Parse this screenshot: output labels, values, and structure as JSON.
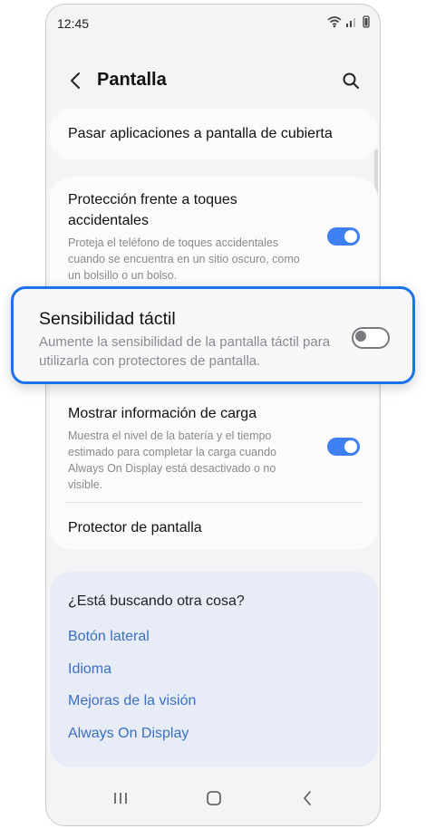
{
  "status_bar": {
    "time": "12:45"
  },
  "header": {
    "title": "Pantalla"
  },
  "settings": {
    "cover_screen_apps": "Pasar aplicaciones a pantalla de cubierta",
    "accidental_touch": {
      "title": "Protección frente a toques accidentales",
      "description": "Proteja el teléfono de toques accidentales cuando se encuentra en un sitio oscuro, como un bolsillo o un bolso.",
      "enabled": true
    },
    "touch_sensitivity": {
      "title": "Sensibilidad táctil",
      "description": "Aumente la sensibilidad de la pantalla táctil para utilizarla con protectores de pantalla.",
      "enabled": false
    },
    "charging_info": {
      "title": "Mostrar información de carga",
      "description": "Muestra el nivel de la batería y el tiempo estimado para completar la carga cuando Always On Display está desactivado o no visible.",
      "enabled": true
    },
    "screen_protector": "Protector de pantalla"
  },
  "suggestions": {
    "title": "¿Está buscando otra cosa?",
    "links": [
      "Botón lateral",
      "Idioma",
      "Mejoras de la visión",
      "Always On Display"
    ]
  },
  "colors": {
    "accent": "#3e7ff2",
    "highlight_border": "#1a73e8",
    "link": "#3a6fc3"
  }
}
